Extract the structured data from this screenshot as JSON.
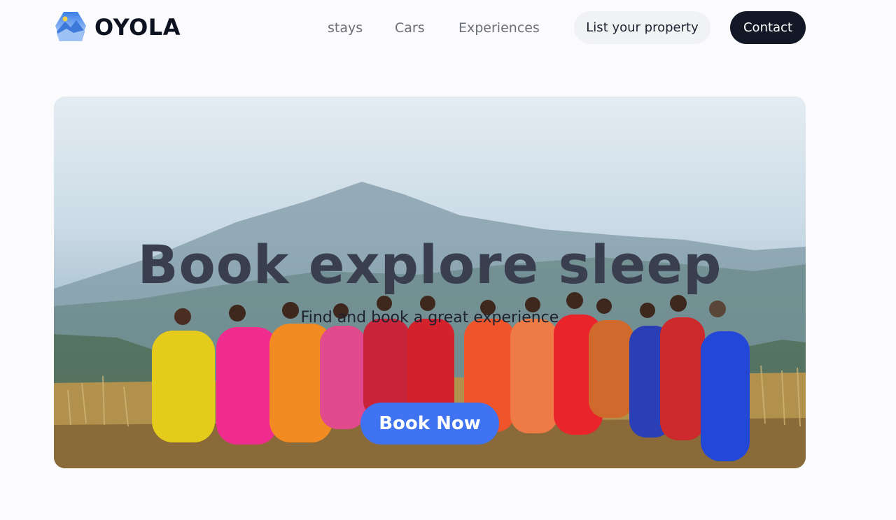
{
  "brand": {
    "name": "OYOLA",
    "logo_icon": "mountain-hexagon-icon",
    "logo_colors": [
      "#4a8ff0",
      "#a7c9f5",
      "#2f6fd6"
    ]
  },
  "nav": {
    "links": [
      {
        "label": "stays"
      },
      {
        "label": "Cars"
      },
      {
        "label": "Experiences"
      }
    ],
    "list_property_label": "List your property",
    "contact_label": "Contact"
  },
  "hero": {
    "title": "Book explore sleep",
    "subtitle": "Find and book a great experience",
    "cta_label": "Book Now",
    "image_subject": "women in colorful saris dancing in a line on a grassy hillside with misty mountains behind",
    "colors": {
      "cta": "#3f73f2",
      "title": "#3a3f4f"
    }
  },
  "colors": {
    "page_bg": "#fbfbfe",
    "contact_bg": "#121826",
    "list_bg": "#f1f2f4",
    "nav_text": "#6b6e76"
  }
}
